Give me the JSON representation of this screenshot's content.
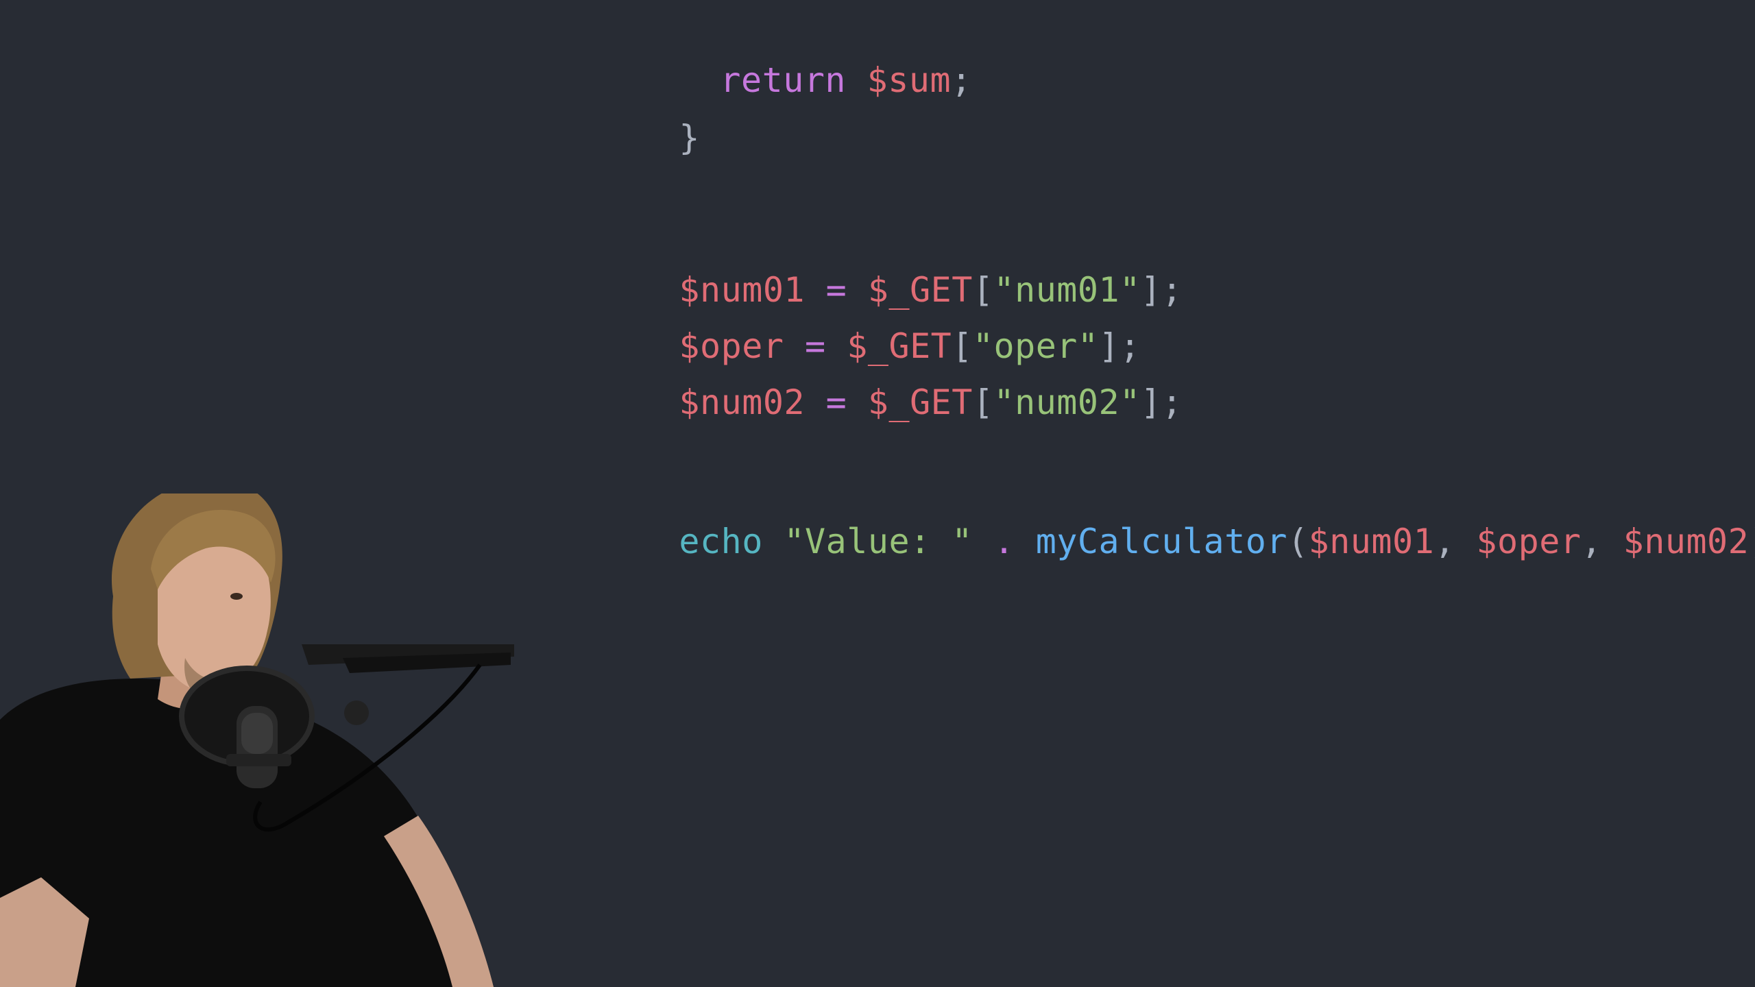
{
  "code": {
    "line1": {
      "keyword": "return",
      "var": "$sum",
      "end": ";"
    },
    "line2": {
      "brace": "}"
    },
    "line3": {
      "var": "$num01",
      "eq": "=",
      "global": "$_GET",
      "open": "[",
      "key": "\"num01\"",
      "close": "];"
    },
    "line4": {
      "var": "$oper",
      "eq": "=",
      "global": "$_GET",
      "open": "[",
      "key": "\"oper\"",
      "close": "];"
    },
    "line5": {
      "var": "$num02",
      "eq": "=",
      "global": "$_GET",
      "open": "[",
      "key": "\"num02\"",
      "close": "];"
    },
    "line6": {
      "keyword": "echo",
      "string": "\"Value: \"",
      "concat": ".",
      "function": "myCalculator",
      "paren_open": "(",
      "arg1": "$num01",
      "comma1": ",",
      "arg2": "$oper",
      "comma2": ",",
      "arg3": "$num02",
      "paren_close": ");"
    }
  },
  "colors": {
    "background": "#282c34",
    "keyword": "#c678dd",
    "variable": "#e06c75",
    "string": "#98c379",
    "function": "#61afef",
    "builtin": "#56b6c2",
    "punctuation": "#abb2bf"
  }
}
